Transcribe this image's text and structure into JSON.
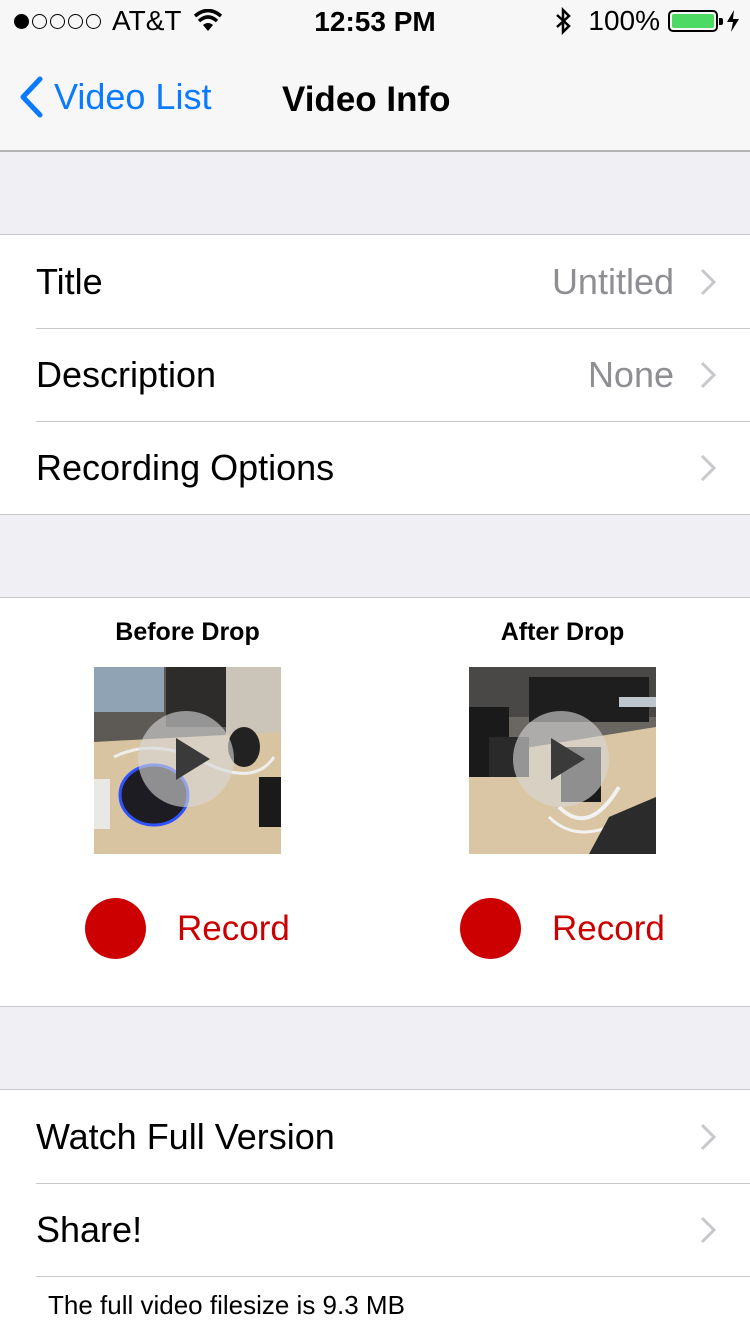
{
  "status_bar": {
    "carrier": "AT&T",
    "time": "12:53 PM",
    "battery_percent": "100%",
    "signal_bars_filled": 1,
    "battery_color": "#4cd964"
  },
  "nav": {
    "back_label": "Video List",
    "title": "Video Info",
    "accent_color": "#0a7aff"
  },
  "details": {
    "title_label": "Title",
    "title_value": "Untitled",
    "description_label": "Description",
    "description_value": "None",
    "recording_options_label": "Recording Options"
  },
  "media": {
    "before": {
      "heading": "Before Drop",
      "record_label": "Record"
    },
    "after": {
      "heading": "After Drop",
      "record_label": "Record"
    },
    "record_color": "#cc0000"
  },
  "actions": {
    "watch_label": "Watch Full Version",
    "share_label": "Share!",
    "filesize_note": "The full video filesize is 9.3 MB"
  }
}
